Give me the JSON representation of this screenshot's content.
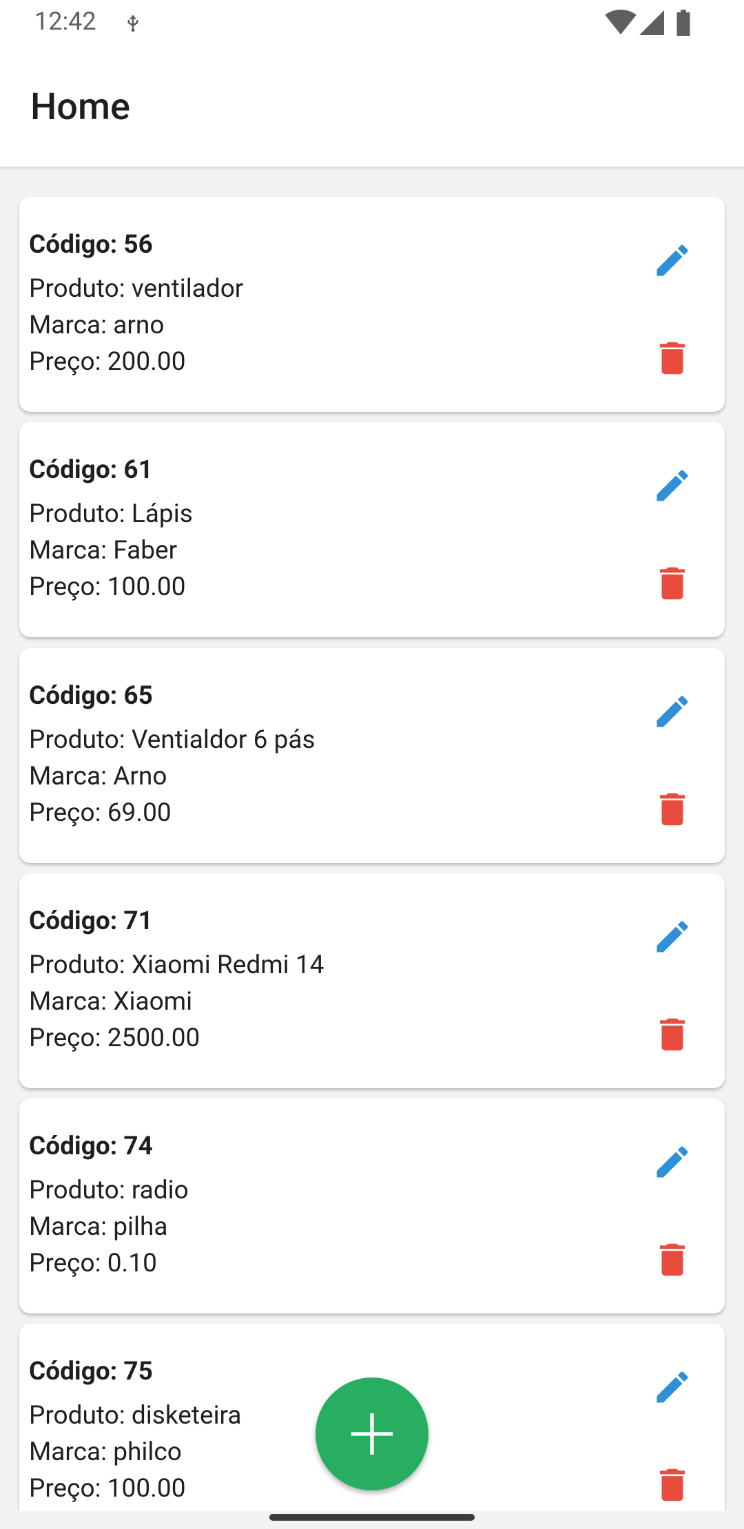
{
  "status_bar": {
    "time": "12:42",
    "icons": [
      "usb-debug-icon",
      "wifi-icon",
      "signal-icon",
      "battery-icon"
    ]
  },
  "app_bar": {
    "title": "Home"
  },
  "colors": {
    "edit_icon": "#2f8fd8",
    "delete_icon": "#e74c3c",
    "fab": "#27ae60"
  },
  "products": [
    {
      "code": "Código: 56",
      "product": "Produto: ventilador",
      "brand": "Marca: arno",
      "price": "Preço: 200.00"
    },
    {
      "code": "Código: 61",
      "product": "Produto: Lápis",
      "brand": "Marca: Faber",
      "price": "Preço: 100.00"
    },
    {
      "code": "Código: 65",
      "product": "Produto: Ventialdor 6 pás",
      "brand": "Marca: Arno",
      "price": "Preço: 69.00"
    },
    {
      "code": "Código: 71",
      "product": "Produto: Xiaomi Redmi 14",
      "brand": "Marca: Xiaomi",
      "price": "Preço: 2500.00"
    },
    {
      "code": "Código: 74",
      "product": "Produto: radio",
      "brand": "Marca: pilha",
      "price": "Preço: 0.10"
    },
    {
      "code": "Código: 75",
      "product": "Produto: disketeira",
      "brand": "Marca: philco",
      "price": "Preço: 100.00"
    }
  ],
  "fab": {
    "icon": "plus-icon"
  }
}
